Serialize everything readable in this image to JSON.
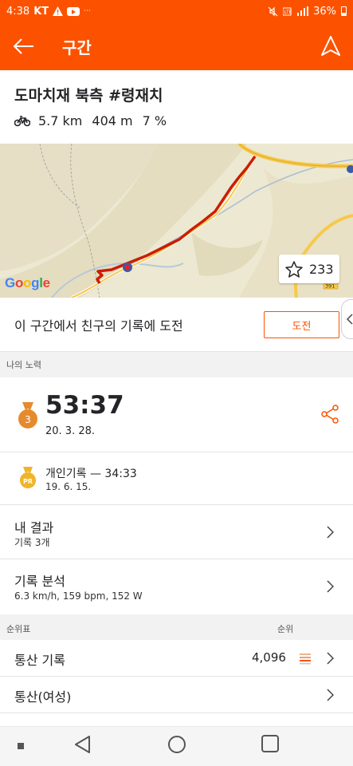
{
  "status_bar": {
    "time": "4:38",
    "carrier": "KT",
    "warning_icon": "warning-icon",
    "youtube_icon": "youtube-icon",
    "dots": "···",
    "battery_percent": "36%"
  },
  "app_bar": {
    "title": "구간",
    "back_icon": "arrow-left-icon",
    "navigate_icon": "navigation-arrow-icon"
  },
  "segment": {
    "name": "도마치재 북측 #령재치",
    "activity_icon": "bike-icon",
    "distance": "5.7 km",
    "elevation": "404 m",
    "grade": "7 %"
  },
  "map": {
    "logo": "Google",
    "star_count": "233",
    "road_sign": "391"
  },
  "challenge": {
    "text": "이 구간에서 친구의 기록에 도전",
    "button": "도전"
  },
  "my_efforts": {
    "section_label": "나의 노력",
    "latest": {
      "rank": "3",
      "time": "53:37",
      "date": "20. 3. 28."
    },
    "pr": {
      "badge": "PR",
      "title": "개인기록 — 34:33",
      "date": "19. 6. 15."
    }
  },
  "results": {
    "title": "내 결과",
    "subtitle": "기록 3개"
  },
  "analysis": {
    "title": "기록 분석",
    "subtitle": "6.3 km/h, 159 bpm, 152 W"
  },
  "leaderboard": {
    "label": "순위표",
    "rank_label": "순위",
    "overall": {
      "title": "통산 기록",
      "rank": "4,096"
    },
    "women": {
      "title": "통산(여성)"
    }
  },
  "colors": {
    "brand": "#fc5200",
    "route": "#cc1d00",
    "medal": "#e68a2e",
    "pr_gold": "#f0b429"
  }
}
